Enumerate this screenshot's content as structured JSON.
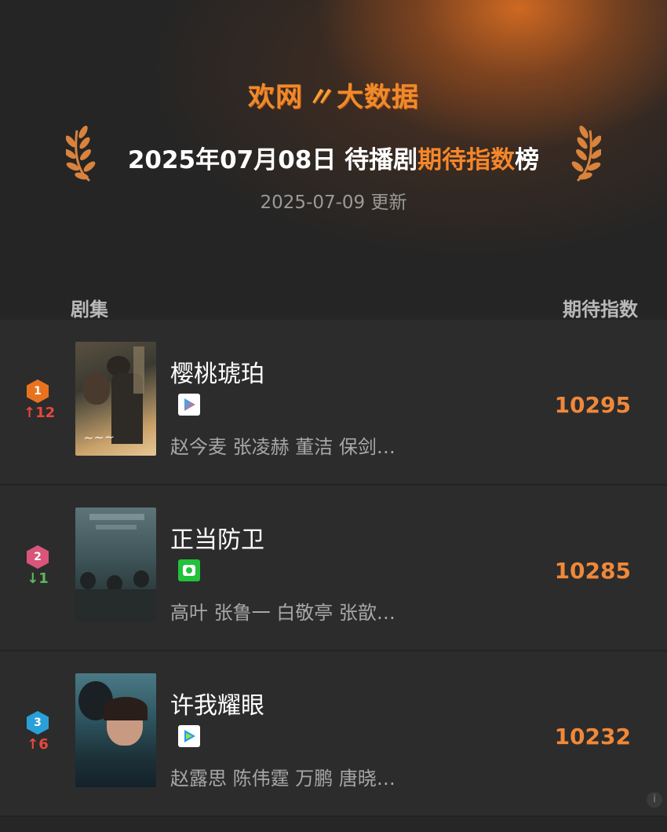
{
  "header": {
    "logo_part1": "欢网",
    "logo_mark": "〃",
    "logo_part2": "大数据",
    "title_prefix": "2025年07月08日 待播剧",
    "title_accent": "期待指数",
    "title_suffix": "榜",
    "update_text": "2025-07-09 更新"
  },
  "columns": {
    "left": "剧集",
    "right": "期待指数"
  },
  "rows": [
    {
      "rank": "1",
      "change": "12",
      "change_dir": "up",
      "title": "樱桃琥珀",
      "cast": "赵今麦 张凌赫 董洁 保剑…",
      "score": "10295",
      "platform_icon": "youku-icon",
      "rank_color": "#e8731f"
    },
    {
      "rank": "2",
      "change": "1",
      "change_dir": "down",
      "title": "正当防卫",
      "cast": "高叶 张鲁一 白敬亭 张歆…",
      "score": "10285",
      "platform_icon": "iqiyi-icon",
      "rank_color": "#d9557a"
    },
    {
      "rank": "3",
      "change": "6",
      "change_dir": "up",
      "title": "许我耀眼",
      "cast": "赵露思 陈伟霆 万鹏 唐晓…",
      "score": "10232",
      "platform_icon": "tencent-video-icon",
      "rank_color": "#2aa0d8"
    }
  ],
  "colors": {
    "accent": "#f5872a",
    "up": "#e8483c",
    "down": "#5cb85c"
  }
}
